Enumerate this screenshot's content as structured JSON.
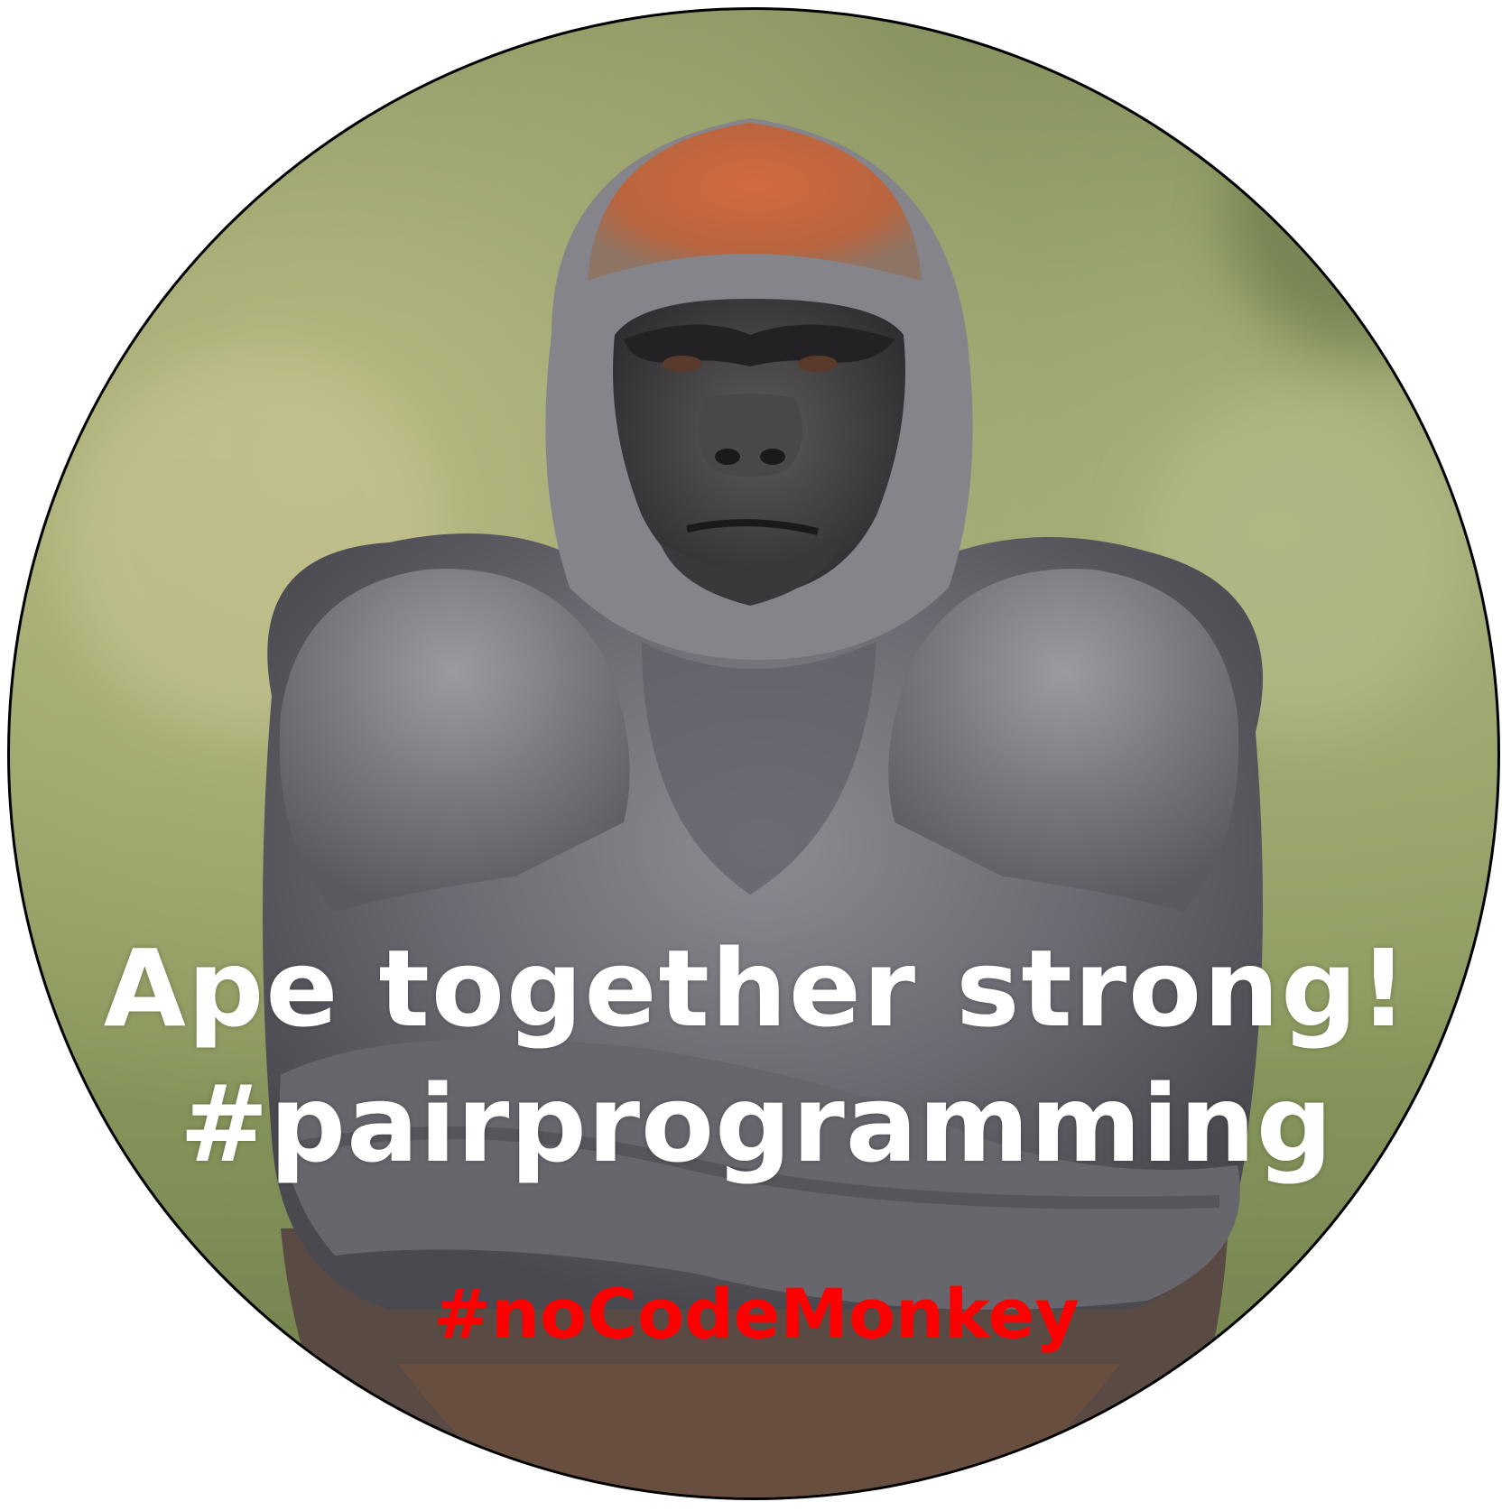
{
  "sticker": {
    "subject": "silverback gorilla with crossed arms",
    "background_color": "#8c9a5f",
    "border_color": "#000000"
  },
  "caption": {
    "line1": "Ape together strong!",
    "line2": "#pairprogramming",
    "hashtag": "#noCodeMonkey",
    "line_color": "#ffffff",
    "hashtag_color": "#ff0000"
  }
}
